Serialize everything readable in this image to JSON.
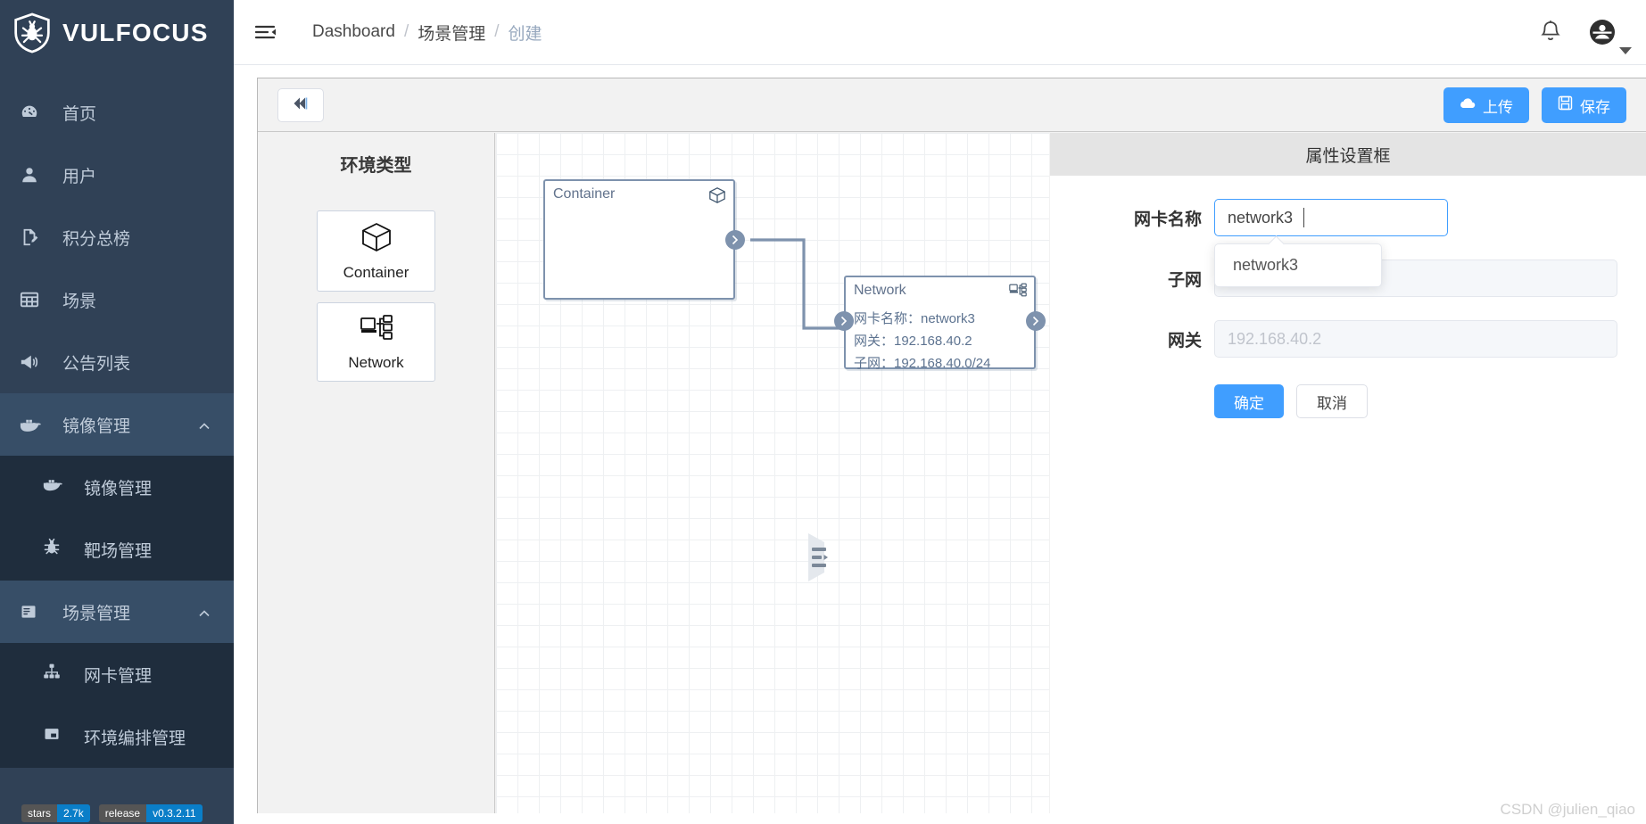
{
  "brand": {
    "name": "VULFOCUS",
    "logo_icon": "shield-bug-icon"
  },
  "sidebar": {
    "items": [
      {
        "label": "首页",
        "icon": "dashboard-icon",
        "type": "item"
      },
      {
        "label": "用户",
        "icon": "user-icon",
        "type": "item"
      },
      {
        "label": "积分总榜",
        "icon": "document-icon",
        "type": "item"
      },
      {
        "label": "场景",
        "icon": "grid-icon",
        "type": "item"
      },
      {
        "label": "公告列表",
        "icon": "megaphone-icon",
        "type": "item"
      },
      {
        "label": "镜像管理",
        "icon": "docker-icon",
        "type": "group",
        "expanded": true,
        "children": [
          {
            "label": "镜像管理",
            "icon": "docker-icon"
          },
          {
            "label": "靶场管理",
            "icon": "bug-icon"
          }
        ]
      },
      {
        "label": "场景管理",
        "icon": "board-icon",
        "type": "group",
        "expanded": true,
        "children": [
          {
            "label": "网卡管理",
            "icon": "sitemap-icon"
          },
          {
            "label": "环境编排管理",
            "icon": "window-icon"
          }
        ]
      }
    ],
    "badges": [
      {
        "left": "stars",
        "right": "2.7k"
      },
      {
        "left": "release",
        "right": "v0.3.2.11"
      }
    ]
  },
  "header": {
    "menu_icon": "hamburger-icon",
    "breadcrumb": [
      {
        "label": "Dashboard",
        "current": false
      },
      {
        "label": "场景管理",
        "current": false
      },
      {
        "label": "创建",
        "current": true
      }
    ],
    "separator": "/",
    "bell_icon": "bell-icon",
    "avatar_icon": "user-avatar-icon",
    "caret_icon": "caret-down-icon"
  },
  "toolbar": {
    "collapse_icon": "double-chevron-left-icon",
    "upload_label": "上传",
    "upload_icon": "cloud-upload-icon",
    "save_label": "保存",
    "save_icon": "floppy-save-icon"
  },
  "palette": {
    "title": "环境类型",
    "cards": [
      {
        "label": "Container",
        "icon": "box-3d-icon"
      },
      {
        "label": "Network",
        "icon": "network-icon"
      }
    ]
  },
  "canvas": {
    "collapse_handle_icon": "panel-collapse-icon",
    "nodes": [
      {
        "title": "Container",
        "icon": "box-3d-icon",
        "lines": []
      },
      {
        "title": "Network",
        "icon": "network-icon",
        "lines": [
          "网卡名称：network3",
          "网关：192.168.40.2",
          "子网：192.168.40.0/24"
        ]
      }
    ]
  },
  "properties": {
    "title": "属性设置框",
    "fields": [
      {
        "label": "网卡名称",
        "value": "network3",
        "placeholder": "",
        "disabled": false
      },
      {
        "label": "子网",
        "value": "",
        "placeholder": "",
        "disabled": true
      },
      {
        "label": "网关",
        "value": "",
        "placeholder": "192.168.40.2",
        "disabled": true
      }
    ],
    "autocomplete": {
      "options": [
        "network3"
      ]
    },
    "confirm_label": "确定",
    "cancel_label": "取消"
  },
  "watermark": "CSDN @julien_qiao",
  "colors": {
    "sidebar_bg": "#304156",
    "sidebar_sub_bg": "#1f2d3d",
    "accent": "#409eff",
    "node_border": "#7e92ad"
  }
}
